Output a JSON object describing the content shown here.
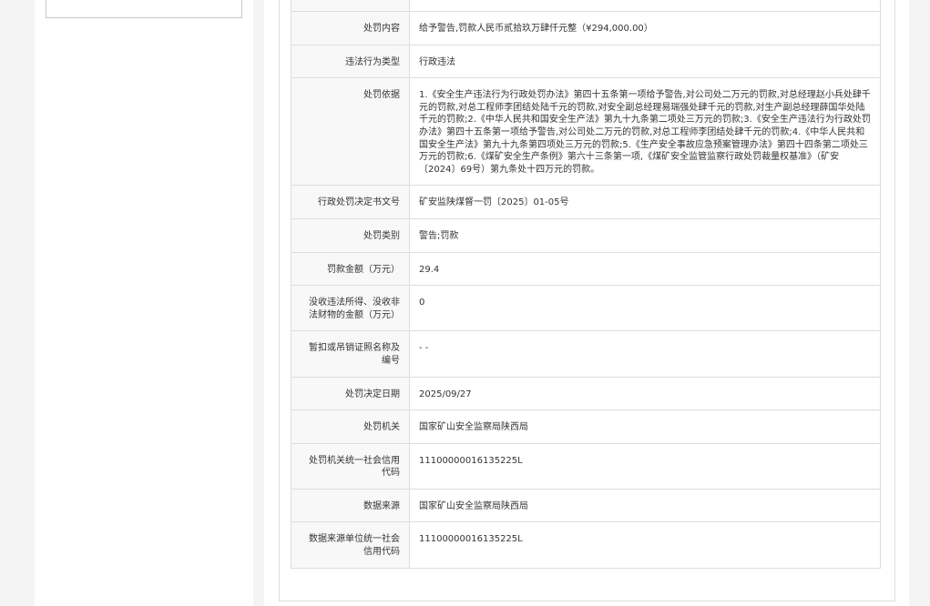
{
  "rows": [
    {
      "label": "",
      "value": ""
    },
    {
      "label": "处罚内容",
      "value": "给予警告,罚款人民币贰拾玖万肆仟元整（¥294,000.00）"
    },
    {
      "label": "违法行为类型",
      "value": "行政违法"
    },
    {
      "label": "处罚依据",
      "value": "1.《安全生产违法行为行政处罚办法》第四十五条第一项给予警告,对公司处二万元的罚款,对总经理赵小兵处肆千元的罚款,对总工程师李团结处陆千元的罚款,对安全副总经理易瑞强处肆千元的罚款,对生产副总经理薛国华处陆千元的罚款;2.《中华人民共和国安全生产法》第九十九条第二项处三万元的罚款;3.《安全生产违法行为行政处罚办法》第四十五条第一项给予警告,对公司处二万元的罚款,对总工程师李团结处肆千元的罚款;4.《中华人民共和国安全生产法》第九十九条第四项处三万元的罚款;5.《生产安全事故应急预案管理办法》第四十四条第二项处三万元的罚款;6.《煤矿安全生产条例》第六十三条第一项,《煤矿安全监管监察行政处罚裁量权基准》（矿安〔2024〕69号）第九条处十四万元的罚款。"
    },
    {
      "label": "行政处罚决定书文号",
      "value": "矿安监陕煤督一罚〔2025〕01-05号"
    },
    {
      "label": "处罚类别",
      "value": "警告;罚款"
    },
    {
      "label": "罚款金额（万元）",
      "value": "29.4"
    },
    {
      "label": "没收违法所得、没收非法财物的金额（万元）",
      "value": "0"
    },
    {
      "label": "暂扣或吊销证照名称及编号",
      "value": "- -"
    },
    {
      "label": "处罚决定日期",
      "value": "2025/09/27"
    },
    {
      "label": "处罚机关",
      "value": "国家矿山安全监察局陕西局"
    },
    {
      "label": "处罚机关统一社会信用代码",
      "value": "11100000016135225L"
    },
    {
      "label": "数据来源",
      "value": "国家矿山安全监察局陕西局"
    },
    {
      "label": "数据来源单位统一社会信用代码",
      "value": "11100000016135225L"
    }
  ]
}
